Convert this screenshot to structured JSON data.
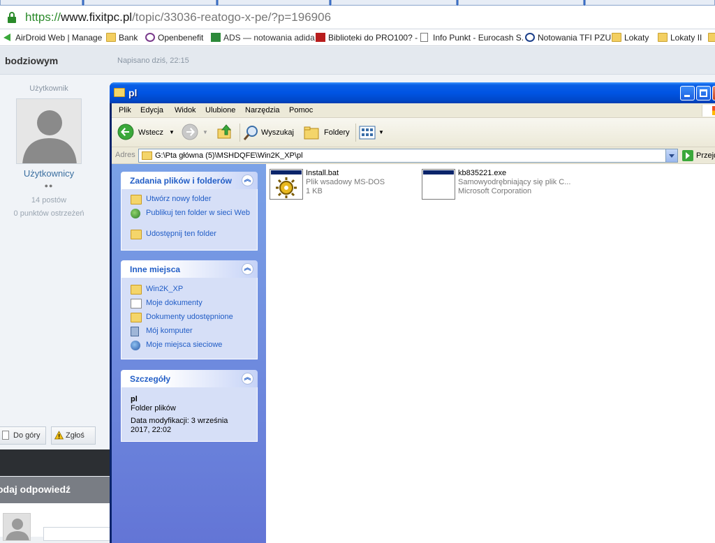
{
  "browser": {
    "url_scheme": "https://",
    "url_host": "www.fixitpc.pl",
    "url_path": "/topic/33036-reatogo-x-pe/?p=196906",
    "bookmarks": [
      {
        "label": "AirDroid Web | Manage",
        "icon": "airdroid-icon"
      },
      {
        "label": "Bank",
        "icon": "folder-icon"
      },
      {
        "label": "Openbenefit",
        "icon": "openbenefit-icon"
      },
      {
        "label": "ADS — notowania adida",
        "icon": "ads-icon"
      },
      {
        "label": "Biblioteki do PRO100? -",
        "icon": "m-icon"
      },
      {
        "label": "Info Punkt - Eurocash S.",
        "icon": "page-icon"
      },
      {
        "label": "Notowania TFI PZU",
        "icon": "pzu-icon"
      },
      {
        "label": "Lokaty",
        "icon": "folder-icon"
      },
      {
        "label": "Lokaty II",
        "icon": "folder-icon"
      }
    ]
  },
  "forum": {
    "poster_name": "bodziowym",
    "posted_at": "Napisano dziś, 22:15",
    "role": "Użytkownik",
    "group": "Użytkownicy",
    "rank_pips": "●●",
    "post_count": "14 postów",
    "warnings": "0 punktów ostrzeżeń",
    "btn_top": "Do góry",
    "btn_report": "Zgłoś",
    "reply_title": "odaj odpowiedź"
  },
  "window": {
    "title": "pl",
    "menu": [
      "Plik",
      "Edycja",
      "Widok",
      "Ulubione",
      "Narzędzia",
      "Pomoc"
    ],
    "toolbar": {
      "back": "Wstecz",
      "search": "Wyszukaj",
      "folders": "Foldery"
    },
    "address_label": "Adres",
    "address_value": "G:\\Pta główna (5)\\MSHDQFE\\Win2K_XP\\pl",
    "go_label": "Przejdź"
  },
  "tasks": {
    "file_tasks": {
      "title": "Zadania plików i folderów",
      "items": [
        "Utwórz nowy folder",
        "Publikuj ten folder w sieci Web",
        "Udostępnij ten folder"
      ]
    },
    "other_places": {
      "title": "Inne miejsca",
      "items": [
        "Win2K_XP",
        "Moje dokumenty",
        "Dokumenty udostępnione",
        "Mój komputer",
        "Moje miejsca sieciowe"
      ]
    },
    "details": {
      "title": "Szczegóły",
      "name": "pl",
      "type": "Folder plików",
      "modified_line1": "Data modyfikacji: 3 września",
      "modified_line2": "2017, 22:02"
    }
  },
  "files": [
    {
      "name": "Install.bat",
      "type": "Plik wsadowy MS-DOS",
      "extra": "1 KB",
      "icon": "batch-file-icon"
    },
    {
      "name": "kb835221.exe",
      "type": "Samowyodrębniający się plik C...",
      "extra": "Microsoft Corporation",
      "icon": "executable-icon"
    }
  ],
  "colors": {
    "xp_title_blue": "#0054e3",
    "task_pane_blue": "#6375d6",
    "link_blue": "#215dc6",
    "url_green": "#2a8a2a"
  }
}
